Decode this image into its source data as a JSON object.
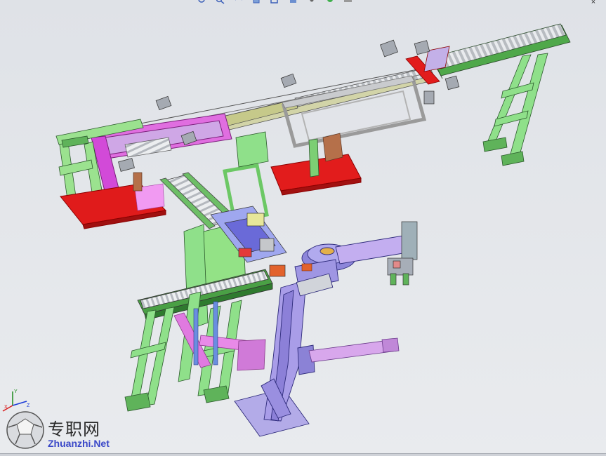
{
  "viewport": {
    "background": "#e4e6ea",
    "hud_toolbar": [
      {
        "icon": "zoom-to-fit-icon"
      },
      {
        "icon": "zoom-area-icon"
      },
      {
        "icon": "previous-view-icon"
      },
      {
        "icon": "section-view-icon"
      },
      {
        "icon": "view-orientation-icon"
      },
      {
        "icon": "display-style-icon"
      },
      {
        "icon": "hide-show-icon"
      },
      {
        "icon": "appearance-icon"
      },
      {
        "icon": "scene-icon"
      }
    ]
  },
  "triad": {
    "x_label": "X",
    "y_label": "Y",
    "z_label": "Z"
  },
  "watermark": {
    "chinese": "专职网",
    "latin": "Zhuanzhi.Net"
  },
  "colors": {
    "frame_green": "#8fe08a",
    "conveyor_gray": "#cfd3d6",
    "platform_red": "#e21c1c",
    "arm_purple": "#a99de8",
    "magenta": "#d24ad8",
    "gripper_lavender": "#c8a6ee",
    "motor_gray": "#9aa0a8"
  }
}
